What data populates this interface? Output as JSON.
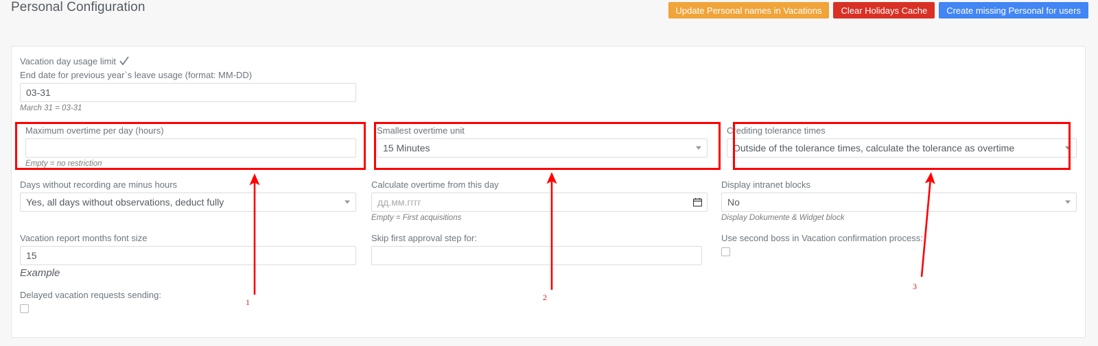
{
  "header": {
    "title": "Personal Configuration",
    "buttons": [
      {
        "label": "Update Personal names in Vacations",
        "color": "#f0a43a",
        "style": "orange"
      },
      {
        "label": "Clear Holidays Cache",
        "color": "#d93025",
        "style": "red"
      },
      {
        "label": "Create missing Personal for users",
        "color": "#4285f4",
        "style": "blue"
      }
    ]
  },
  "form": {
    "col1": {
      "vacation_day_usage_limit": {
        "label": "Vacation day usage limit",
        "checked": true
      },
      "end_date_prev_year": {
        "label": "End date for previous year`s leave usage (format: MM-DD)",
        "value": "03-31",
        "hint": "March 31 = 03-31"
      },
      "max_overtime_per_day": {
        "label": "Maximum overtime per day (hours)",
        "value": "",
        "hint": "Empty = no restriction"
      },
      "days_without_recording": {
        "label": "Days without recording are minus hours",
        "value": "Yes, all days without observations, deduct fully"
      },
      "vacation_report_font_size": {
        "label": "Vacation report months font size",
        "value": "15",
        "hint": "Example"
      },
      "delayed_vacation_requests": {
        "label": "Delayed vacation requests sending:",
        "checked": false
      }
    },
    "col2": {
      "smallest_overtime_unit": {
        "label": "Smallest overtime unit",
        "value": "15 Minutes"
      },
      "calculate_overtime_from": {
        "label": "Calculate overtime from this day",
        "placeholder": "дд.мм.гггг",
        "value": "",
        "hint": "Empty = First acquisitions"
      },
      "skip_first_approval": {
        "label": "Skip first approval step for:",
        "value": ""
      }
    },
    "col3": {
      "crediting_tolerance_times": {
        "label": "Crediting tolerance times",
        "value": "Outside of the tolerance times, calculate the tolerance as overtime"
      },
      "display_intranet_blocks": {
        "label": "Display intranet blocks",
        "value": "No",
        "hint": "Display Dokumente & Widget block"
      },
      "use_second_boss": {
        "label": "Use second boss in Vacation confirmation process:",
        "checked": false
      }
    }
  },
  "annotations": {
    "color": "#fe0000",
    "items": [
      {
        "number": "1",
        "target": "max-overtime-per-day"
      },
      {
        "number": "2",
        "target": "smallest-overtime-unit"
      },
      {
        "number": "3",
        "target": "crediting-tolerance-times"
      }
    ]
  }
}
